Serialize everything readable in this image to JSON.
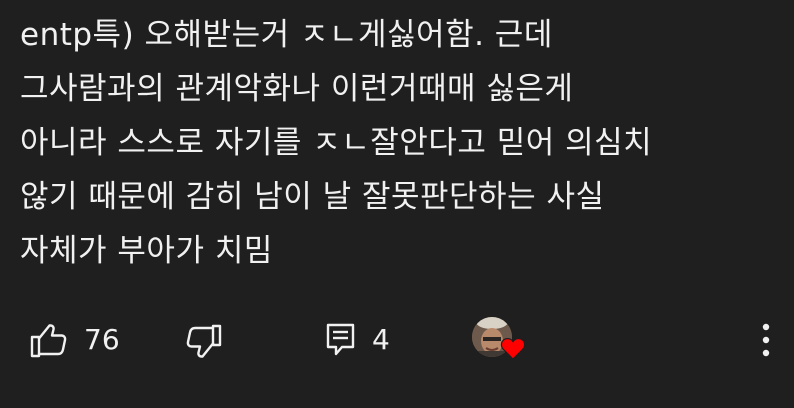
{
  "comment": {
    "lines": [
      "entp특) 오해받는거 ㅈㄴ게싫어함. 근데",
      "그사람과의 관계악화나 이런거때매 싫은게",
      "아니라 스스로 자기를 ㅈㄴ잘안다고 믿어 의심치",
      "않기 때문에 감히 남이 날 잘못판단하는 사실",
      "자체가 부아가 치밈"
    ]
  },
  "actions": {
    "like_count": "76",
    "reply_count": "4",
    "icons": {
      "like": "thumbs-up-outline",
      "dislike": "thumbs-down-outline",
      "reply": "comment-box",
      "creator_heart": "heart-red",
      "more": "vertical-ellipsis"
    }
  },
  "colors": {
    "background": "#1f1f1f",
    "text": "#f1f1f1",
    "heart": "#ff0000"
  }
}
